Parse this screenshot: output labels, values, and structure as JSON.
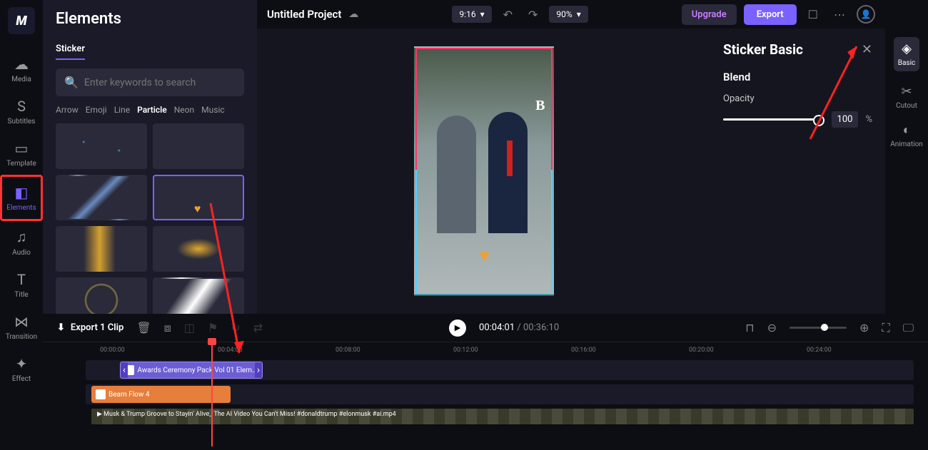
{
  "logo": "M",
  "sidebar": {
    "items": [
      {
        "icon": "☁",
        "label": "Media"
      },
      {
        "icon": "S",
        "label": "Subtitles"
      },
      {
        "icon": "▭",
        "label": "Template"
      },
      {
        "icon": "◧",
        "label": "Elements"
      },
      {
        "icon": "♫",
        "label": "Audio"
      },
      {
        "icon": "T",
        "label": "Title"
      },
      {
        "icon": "⋈",
        "label": "Transition"
      },
      {
        "icon": "✦",
        "label": "Effect"
      }
    ]
  },
  "panel": {
    "title": "Elements",
    "tab": "Sticker",
    "search_placeholder": "Enter keywords to search",
    "categories": [
      "Arrow",
      "Emoji",
      "Line",
      "Particle",
      "Neon",
      "Music"
    ],
    "active_category": "Particle"
  },
  "topbar": {
    "project": "Untitled Project",
    "ratio": "9:16",
    "zoom": "90%",
    "upgrade": "Upgrade",
    "export": "Export"
  },
  "preview": {
    "letter": "B"
  },
  "right_panel": {
    "title": "Sticker Basic",
    "section": "Blend",
    "opacity_label": "Opacity",
    "opacity_value": "100",
    "opacity_unit": "%"
  },
  "far_right": {
    "items": [
      {
        "icon": "◈",
        "label": "Basic"
      },
      {
        "icon": "✂",
        "label": "Cutout"
      },
      {
        "icon": "◐",
        "label": "Animation"
      }
    ]
  },
  "timeline": {
    "export_clip": "Export 1 Clip",
    "current": "00:04:01",
    "total": "00:36:10",
    "ruler": [
      "00:00:00",
      "00:04:00",
      "00:08:00",
      "00:12:00",
      "00:16:00",
      "00:20:00",
      "00:24:00"
    ],
    "clip1": "Awards Ceremony Pack Vol 01 Elem...",
    "clip2": "Beam Flow 4",
    "video": "Musk & Trump Groove to Stayin' Alive_ The AI Video You Can't Miss! #donaldtrump #elonmusk #ai.mp4"
  }
}
